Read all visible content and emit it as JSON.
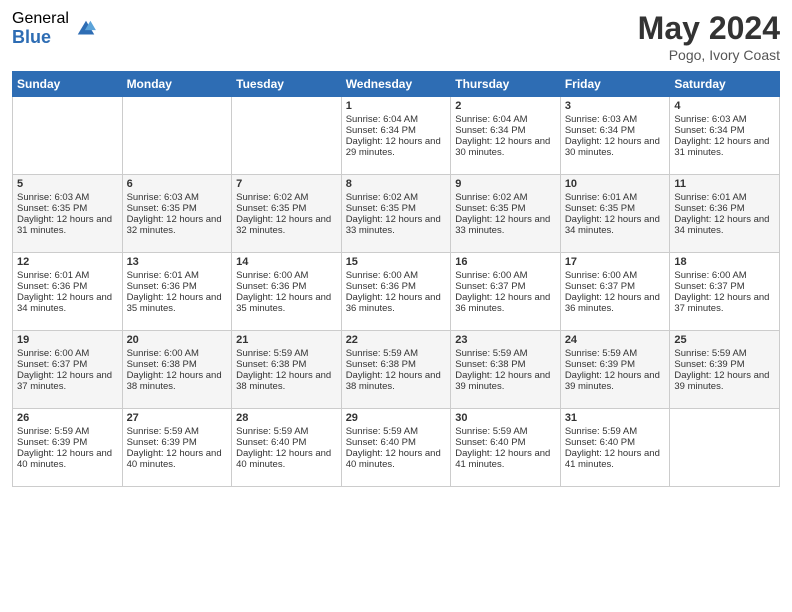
{
  "header": {
    "logo_general": "General",
    "logo_blue": "Blue",
    "month_title": "May 2024",
    "location": "Pogo, Ivory Coast"
  },
  "weekdays": [
    "Sunday",
    "Monday",
    "Tuesday",
    "Wednesday",
    "Thursday",
    "Friday",
    "Saturday"
  ],
  "weeks": [
    [
      {
        "day": "",
        "sunrise": "",
        "sunset": "",
        "daylight": ""
      },
      {
        "day": "",
        "sunrise": "",
        "sunset": "",
        "daylight": ""
      },
      {
        "day": "",
        "sunrise": "",
        "sunset": "",
        "daylight": ""
      },
      {
        "day": "1",
        "sunrise": "Sunrise: 6:04 AM",
        "sunset": "Sunset: 6:34 PM",
        "daylight": "Daylight: 12 hours and 29 minutes."
      },
      {
        "day": "2",
        "sunrise": "Sunrise: 6:04 AM",
        "sunset": "Sunset: 6:34 PM",
        "daylight": "Daylight: 12 hours and 30 minutes."
      },
      {
        "day": "3",
        "sunrise": "Sunrise: 6:03 AM",
        "sunset": "Sunset: 6:34 PM",
        "daylight": "Daylight: 12 hours and 30 minutes."
      },
      {
        "day": "4",
        "sunrise": "Sunrise: 6:03 AM",
        "sunset": "Sunset: 6:34 PM",
        "daylight": "Daylight: 12 hours and 31 minutes."
      }
    ],
    [
      {
        "day": "5",
        "sunrise": "Sunrise: 6:03 AM",
        "sunset": "Sunset: 6:35 PM",
        "daylight": "Daylight: 12 hours and 31 minutes."
      },
      {
        "day": "6",
        "sunrise": "Sunrise: 6:03 AM",
        "sunset": "Sunset: 6:35 PM",
        "daylight": "Daylight: 12 hours and 32 minutes."
      },
      {
        "day": "7",
        "sunrise": "Sunrise: 6:02 AM",
        "sunset": "Sunset: 6:35 PM",
        "daylight": "Daylight: 12 hours and 32 minutes."
      },
      {
        "day": "8",
        "sunrise": "Sunrise: 6:02 AM",
        "sunset": "Sunset: 6:35 PM",
        "daylight": "Daylight: 12 hours and 33 minutes."
      },
      {
        "day": "9",
        "sunrise": "Sunrise: 6:02 AM",
        "sunset": "Sunset: 6:35 PM",
        "daylight": "Daylight: 12 hours and 33 minutes."
      },
      {
        "day": "10",
        "sunrise": "Sunrise: 6:01 AM",
        "sunset": "Sunset: 6:35 PM",
        "daylight": "Daylight: 12 hours and 34 minutes."
      },
      {
        "day": "11",
        "sunrise": "Sunrise: 6:01 AM",
        "sunset": "Sunset: 6:36 PM",
        "daylight": "Daylight: 12 hours and 34 minutes."
      }
    ],
    [
      {
        "day": "12",
        "sunrise": "Sunrise: 6:01 AM",
        "sunset": "Sunset: 6:36 PM",
        "daylight": "Daylight: 12 hours and 34 minutes."
      },
      {
        "day": "13",
        "sunrise": "Sunrise: 6:01 AM",
        "sunset": "Sunset: 6:36 PM",
        "daylight": "Daylight: 12 hours and 35 minutes."
      },
      {
        "day": "14",
        "sunrise": "Sunrise: 6:00 AM",
        "sunset": "Sunset: 6:36 PM",
        "daylight": "Daylight: 12 hours and 35 minutes."
      },
      {
        "day": "15",
        "sunrise": "Sunrise: 6:00 AM",
        "sunset": "Sunset: 6:36 PM",
        "daylight": "Daylight: 12 hours and 36 minutes."
      },
      {
        "day": "16",
        "sunrise": "Sunrise: 6:00 AM",
        "sunset": "Sunset: 6:37 PM",
        "daylight": "Daylight: 12 hours and 36 minutes."
      },
      {
        "day": "17",
        "sunrise": "Sunrise: 6:00 AM",
        "sunset": "Sunset: 6:37 PM",
        "daylight": "Daylight: 12 hours and 36 minutes."
      },
      {
        "day": "18",
        "sunrise": "Sunrise: 6:00 AM",
        "sunset": "Sunset: 6:37 PM",
        "daylight": "Daylight: 12 hours and 37 minutes."
      }
    ],
    [
      {
        "day": "19",
        "sunrise": "Sunrise: 6:00 AM",
        "sunset": "Sunset: 6:37 PM",
        "daylight": "Daylight: 12 hours and 37 minutes."
      },
      {
        "day": "20",
        "sunrise": "Sunrise: 6:00 AM",
        "sunset": "Sunset: 6:38 PM",
        "daylight": "Daylight: 12 hours and 38 minutes."
      },
      {
        "day": "21",
        "sunrise": "Sunrise: 5:59 AM",
        "sunset": "Sunset: 6:38 PM",
        "daylight": "Daylight: 12 hours and 38 minutes."
      },
      {
        "day": "22",
        "sunrise": "Sunrise: 5:59 AM",
        "sunset": "Sunset: 6:38 PM",
        "daylight": "Daylight: 12 hours and 38 minutes."
      },
      {
        "day": "23",
        "sunrise": "Sunrise: 5:59 AM",
        "sunset": "Sunset: 6:38 PM",
        "daylight": "Daylight: 12 hours and 39 minutes."
      },
      {
        "day": "24",
        "sunrise": "Sunrise: 5:59 AM",
        "sunset": "Sunset: 6:39 PM",
        "daylight": "Daylight: 12 hours and 39 minutes."
      },
      {
        "day": "25",
        "sunrise": "Sunrise: 5:59 AM",
        "sunset": "Sunset: 6:39 PM",
        "daylight": "Daylight: 12 hours and 39 minutes."
      }
    ],
    [
      {
        "day": "26",
        "sunrise": "Sunrise: 5:59 AM",
        "sunset": "Sunset: 6:39 PM",
        "daylight": "Daylight: 12 hours and 40 minutes."
      },
      {
        "day": "27",
        "sunrise": "Sunrise: 5:59 AM",
        "sunset": "Sunset: 6:39 PM",
        "daylight": "Daylight: 12 hours and 40 minutes."
      },
      {
        "day": "28",
        "sunrise": "Sunrise: 5:59 AM",
        "sunset": "Sunset: 6:40 PM",
        "daylight": "Daylight: 12 hours and 40 minutes."
      },
      {
        "day": "29",
        "sunrise": "Sunrise: 5:59 AM",
        "sunset": "Sunset: 6:40 PM",
        "daylight": "Daylight: 12 hours and 40 minutes."
      },
      {
        "day": "30",
        "sunrise": "Sunrise: 5:59 AM",
        "sunset": "Sunset: 6:40 PM",
        "daylight": "Daylight: 12 hours and 41 minutes."
      },
      {
        "day": "31",
        "sunrise": "Sunrise: 5:59 AM",
        "sunset": "Sunset: 6:40 PM",
        "daylight": "Daylight: 12 hours and 41 minutes."
      },
      {
        "day": "",
        "sunrise": "",
        "sunset": "",
        "daylight": ""
      }
    ]
  ]
}
